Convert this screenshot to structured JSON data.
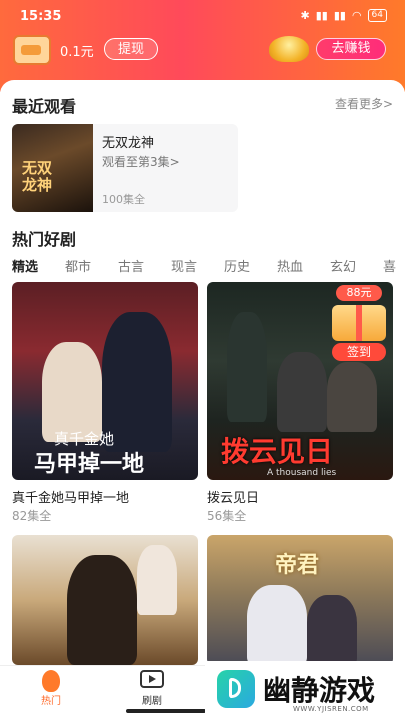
{
  "status": {
    "time": "15:35",
    "icons": [
      "bluetooth-icon",
      "nfc-icon",
      "signal-icon",
      "signal-icon",
      "wifi-icon"
    ],
    "battery": "64"
  },
  "header": {
    "balance": "0.1元",
    "withdraw": "提现",
    "earn": "去赚钱"
  },
  "recent": {
    "title": "最近观看",
    "more": "查看更多>",
    "item": {
      "name": "无双龙神",
      "progress": "观看至第3集>",
      "episodes": "100集全",
      "poster_text": "无双\n龙神"
    }
  },
  "hot": {
    "title": "热门好剧",
    "tabs": [
      "精选",
      "都市",
      "古言",
      "现言",
      "历史",
      "热血",
      "玄幻",
      "喜"
    ]
  },
  "cards": [
    {
      "title": "真千金她马甲掉一地",
      "episodes": "82集全",
      "poster_line1": "真千金她",
      "poster_line2": "马甲掉一地"
    },
    {
      "title": "拨云见日",
      "episodes": "56集全",
      "poster_title": "拨云见日",
      "poster_sub": "A thousand lies"
    },
    {
      "title": "",
      "episodes": ""
    },
    {
      "title": "",
      "episodes": "",
      "poster_title": "帝君"
    }
  ],
  "gift": {
    "price": "88元",
    "sign": "签到"
  },
  "nav": {
    "home": "热门",
    "series": "刷剧"
  },
  "brand": {
    "name": "幽静游戏",
    "url": "WWW.YJISREN.COM"
  },
  "colors": {
    "accent": "#ff6a2a",
    "header_start": "#ff6a3d",
    "header_mid": "#ff4a5a",
    "earn_pill": "#ff2d7a"
  }
}
